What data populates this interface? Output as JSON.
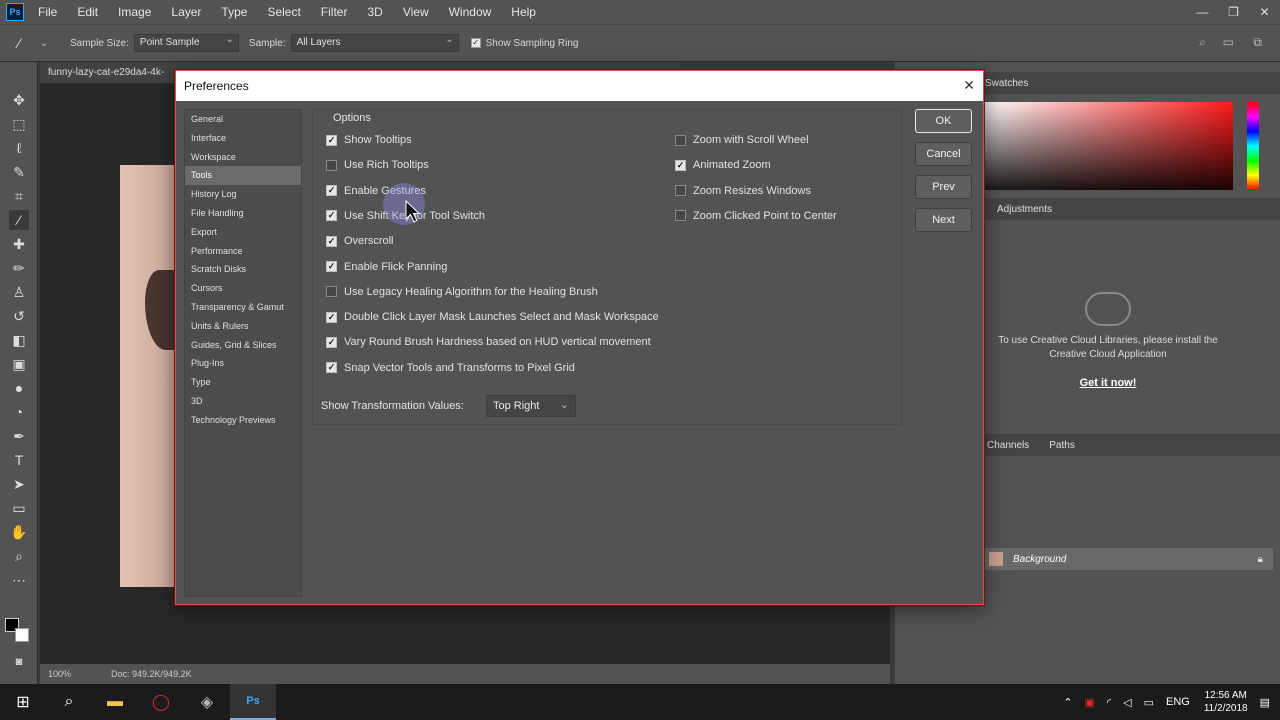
{
  "menubar": {
    "logo": "Ps",
    "items": [
      "File",
      "Edit",
      "Image",
      "Layer",
      "Type",
      "Select",
      "Filter",
      "3D",
      "View",
      "Window",
      "Help"
    ]
  },
  "optionsbar": {
    "sample_size_label": "Sample Size:",
    "sample_size_value": "Point Sample",
    "sample_label": "Sample:",
    "sample_value": "All Layers",
    "show_sampling_ring_label": "Show Sampling Ring"
  },
  "document": {
    "tab_title": "funny-lazy-cat-e29da4-4k-",
    "zoom": "100%",
    "doc_size": "Doc: 949.2K/949.2K"
  },
  "panels": {
    "swatches_tab": "Swatches",
    "adjustments_tab": "Adjustments",
    "cc_message": "To use Creative Cloud Libraries, please install the Creative Cloud Application",
    "cc_link": "Get it now!",
    "channels_tab": "Channels",
    "paths_tab": "Paths",
    "layer_name": "Background"
  },
  "dialog": {
    "title": "Preferences",
    "categories": [
      "General",
      "Interface",
      "Workspace",
      "Tools",
      "History Log",
      "File Handling",
      "Export",
      "Performance",
      "Scratch Disks",
      "Cursors",
      "Transparency & Gamut",
      "Units & Rulers",
      "Guides, Grid & Slices",
      "Plug-Ins",
      "Type",
      "3D",
      "Technology Previews"
    ],
    "selected_category": "Tools",
    "options_legend": "Options",
    "left_options": [
      {
        "label": "Show Tooltips",
        "checked": true
      },
      {
        "label": "Use Rich Tooltips",
        "checked": false
      },
      {
        "label": "Enable Gestures",
        "checked": true
      },
      {
        "label": "Use Shift Key for Tool Switch",
        "checked": true
      },
      {
        "label": "Overscroll",
        "checked": true
      },
      {
        "label": "Enable Flick Panning",
        "checked": true
      },
      {
        "label": "Use Legacy Healing Algorithm for the Healing Brush",
        "checked": false
      },
      {
        "label": "Double Click Layer Mask Launches Select and Mask Workspace",
        "checked": true
      },
      {
        "label": "Vary Round Brush Hardness based on HUD vertical movement",
        "checked": true
      },
      {
        "label": "Snap Vector Tools and Transforms to Pixel Grid",
        "checked": true
      }
    ],
    "right_options": [
      {
        "label": "Zoom with Scroll Wheel",
        "checked": false
      },
      {
        "label": "Animated Zoom",
        "checked": true
      },
      {
        "label": "Zoom Resizes Windows",
        "checked": false
      },
      {
        "label": "Zoom Clicked Point to Center",
        "checked": false
      }
    ],
    "transform_values_label": "Show Transformation Values:",
    "transform_values_value": "Top Right",
    "buttons": {
      "ok": "OK",
      "cancel": "Cancel",
      "prev": "Prev",
      "next": "Next"
    }
  },
  "taskbar": {
    "language": "ENG",
    "time": "12:56 AM",
    "date": "11/2/2018"
  }
}
